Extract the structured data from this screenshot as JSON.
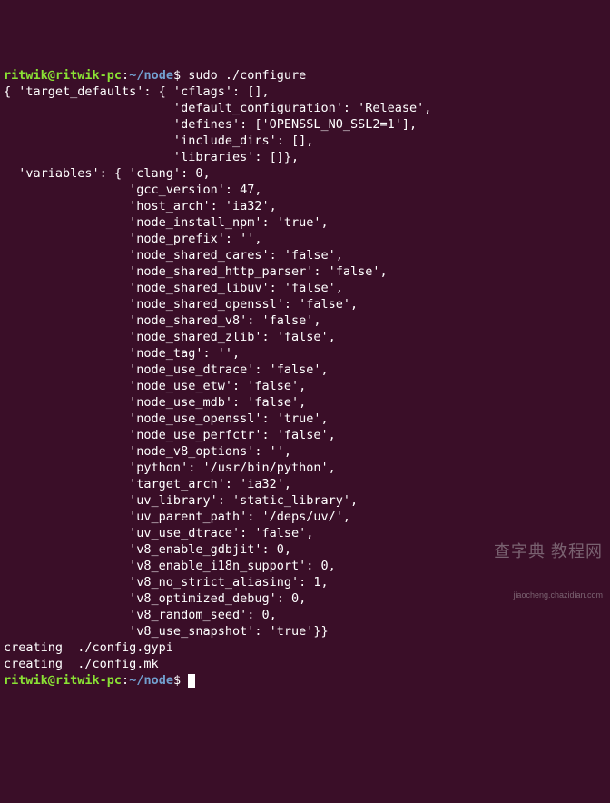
{
  "prompt1": {
    "user": "ritwik@ritwik-pc",
    "colon": ":",
    "path": "~/node",
    "dollar": "$ ",
    "command": "sudo ./configure"
  },
  "lines": [
    "{ 'target_defaults': { 'cflags': [],",
    "                       'default_configuration': 'Release',",
    "                       'defines': ['OPENSSL_NO_SSL2=1'],",
    "                       'include_dirs': [],",
    "                       'libraries': []},",
    "  'variables': { 'clang': 0,",
    "                 'gcc_version': 47,",
    "                 'host_arch': 'ia32',",
    "                 'node_install_npm': 'true',",
    "                 'node_prefix': '',",
    "                 'node_shared_cares': 'false',",
    "                 'node_shared_http_parser': 'false',",
    "                 'node_shared_libuv': 'false',",
    "                 'node_shared_openssl': 'false',",
    "                 'node_shared_v8': 'false',",
    "                 'node_shared_zlib': 'false',",
    "                 'node_tag': '',",
    "                 'node_use_dtrace': 'false',",
    "                 'node_use_etw': 'false',",
    "                 'node_use_mdb': 'false',",
    "                 'node_use_openssl': 'true',",
    "                 'node_use_perfctr': 'false',",
    "                 'node_v8_options': '',",
    "                 'python': '/usr/bin/python',",
    "                 'target_arch': 'ia32',",
    "                 'uv_library': 'static_library',",
    "                 'uv_parent_path': '/deps/uv/',",
    "                 'uv_use_dtrace': 'false',",
    "                 'v8_enable_gdbjit': 0,",
    "                 'v8_enable_i18n_support': 0,",
    "                 'v8_no_strict_aliasing': 1,",
    "                 'v8_optimized_debug': 0,",
    "                 'v8_random_seed': 0,",
    "                 'v8_use_snapshot': 'true'}}",
    "creating  ./config.gypi",
    "creating  ./config.mk"
  ],
  "prompt2": {
    "user": "ritwik@ritwik-pc",
    "colon": ":",
    "path": "~/node",
    "dollar": "$ "
  },
  "watermark": {
    "line1": "查字典 教程网",
    "line2": "jiaocheng.chazidian.com"
  }
}
